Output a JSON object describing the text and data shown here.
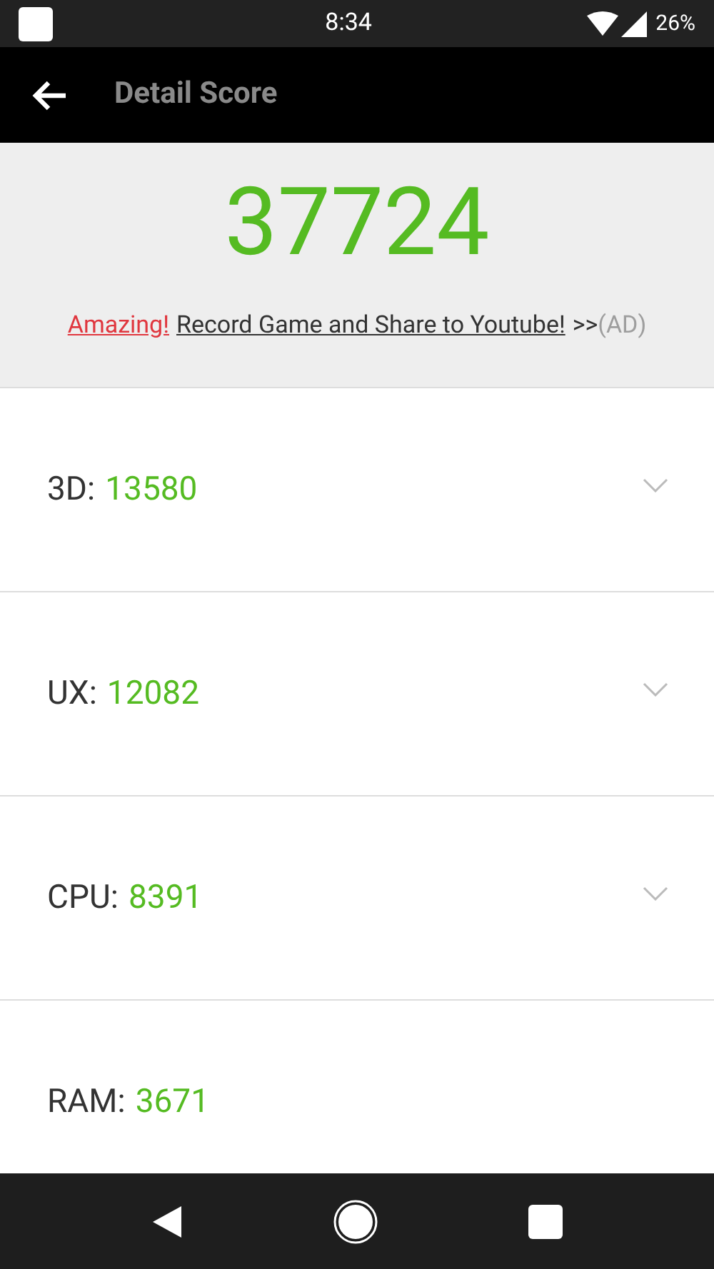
{
  "status_bar": {
    "time": "8:34",
    "battery": "26%"
  },
  "app_bar": {
    "title": "Detail Score"
  },
  "total": {
    "score": "37724",
    "ad": {
      "highlight": "Amazing!",
      "link": "Record Game and Share to Youtube!",
      "arrows": ">>",
      "tag": "(AD)"
    }
  },
  "scores": [
    {
      "label": "3D:",
      "value": "13580",
      "chevron": true
    },
    {
      "label": "UX:",
      "value": "12082",
      "chevron": true
    },
    {
      "label": "CPU:",
      "value": "8391",
      "chevron": true
    },
    {
      "label": "RAM:",
      "value": "3671",
      "chevron": false
    }
  ]
}
